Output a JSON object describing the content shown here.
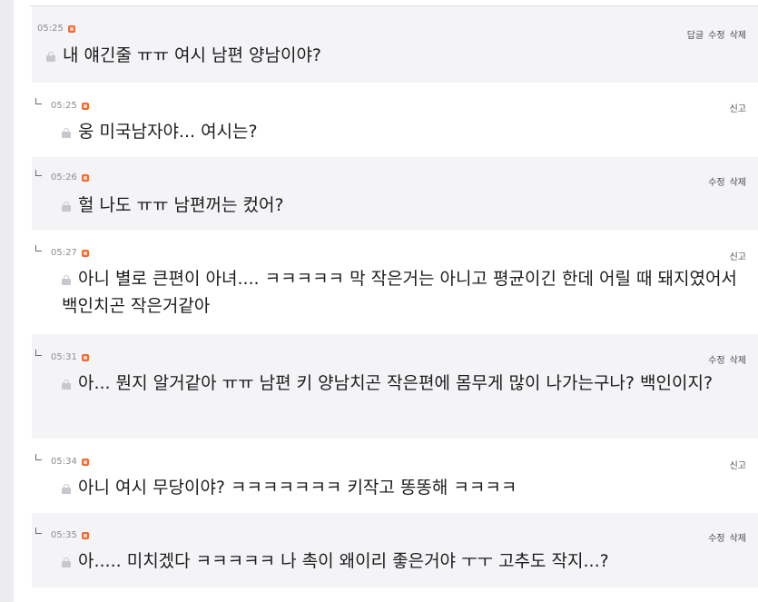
{
  "comments": [
    {
      "time": "05:25",
      "reply": false,
      "actions": [
        "답글",
        "수정",
        "삭제"
      ],
      "text": "내 얘긴줄 ㅠㅠ 여시 남편 양남이야?"
    },
    {
      "time": "05:25",
      "reply": true,
      "actions": [
        "신고"
      ],
      "text": "웅 미국남자야... 여시는?"
    },
    {
      "time": "05:26",
      "reply": true,
      "actions": [
        "수정",
        "삭제"
      ],
      "text": "헐 나도 ㅠㅠ 남편꺼는 컸어?"
    },
    {
      "time": "05:27",
      "reply": true,
      "actions": [
        "신고"
      ],
      "text": "아니 별로 큰편이 아녀.... ㅋㅋㅋㅋㅋ 막 작은거는 아니고 평균이긴 한데 어릴 때 돼지였어서 백인치곤 작은거같아"
    },
    {
      "time": "05:31",
      "reply": true,
      "actions": [
        "수정",
        "삭제"
      ],
      "text": "아... 뭔지 알거같아 ㅠㅠ 남편 키 양남치곤 작은편에 몸무게 많이 나가는구나? 백인이지?"
    },
    {
      "time": "05:34",
      "reply": true,
      "actions": [
        "신고"
      ],
      "text": "아니 여시 무당이야? ㅋㅋㅋㅋㅋㅋㅋ 키작고 똥똥해 ㅋㅋㅋㅋ"
    },
    {
      "time": "05:35",
      "reply": true,
      "actions": [
        "수정",
        "삭제"
      ],
      "text": "아..... 미치겠다 ㅋㅋㅋㅋㅋ 나 촉이 왜이리 좋은거야 ㅜㅜ 고추도 작지...?"
    }
  ]
}
